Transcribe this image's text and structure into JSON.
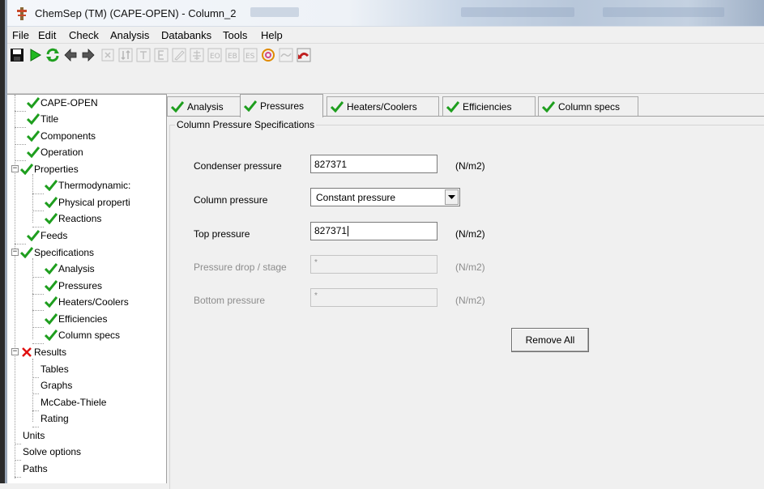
{
  "window": {
    "title": "ChemSep (TM) (CAPE-OPEN) - Column_2"
  },
  "menu": [
    "File",
    "Edit",
    "Check",
    "Analysis",
    "Databanks",
    "Tools",
    "Help"
  ],
  "toolbar": [
    {
      "icon": "save-icon",
      "enabled": true
    },
    {
      "icon": "play-icon",
      "enabled": true
    },
    {
      "icon": "refresh-icon",
      "enabled": true
    },
    {
      "icon": "arrow-left-icon",
      "enabled": true
    },
    {
      "icon": "arrow-right-icon",
      "enabled": true
    },
    {
      "icon": "close-box-icon",
      "enabled": false
    },
    {
      "icon": "sort-icon",
      "enabled": false
    },
    {
      "icon": "table-t-icon",
      "enabled": false
    },
    {
      "icon": "table-e-icon",
      "enabled": false
    },
    {
      "icon": "pen-icon",
      "enabled": false
    },
    {
      "icon": "tree-icon",
      "enabled": false
    },
    {
      "icon": "eo-icon",
      "enabled": false
    },
    {
      "icon": "eb-icon",
      "enabled": false
    },
    {
      "icon": "es-icon",
      "enabled": false
    },
    {
      "icon": "target-icon",
      "enabled": true
    },
    {
      "icon": "wave-icon",
      "enabled": false
    },
    {
      "icon": "undo-icon",
      "enabled": true
    }
  ],
  "tree": {
    "items": [
      {
        "label": "CAPE-OPEN",
        "status": "ok",
        "level": 0
      },
      {
        "label": "Title",
        "status": "ok",
        "level": 0
      },
      {
        "label": "Components",
        "status": "ok",
        "level": 0
      },
      {
        "label": "Operation",
        "status": "ok",
        "level": 0
      },
      {
        "label": "Properties",
        "status": "ok",
        "level": 0,
        "expanded": true
      },
      {
        "label": "Thermodynamic:",
        "status": "ok",
        "level": 1
      },
      {
        "label": "Physical properti",
        "status": "ok",
        "level": 1
      },
      {
        "label": "Reactions",
        "status": "ok",
        "level": 1
      },
      {
        "label": "Feeds",
        "status": "ok",
        "level": 0
      },
      {
        "label": "Specifications",
        "status": "ok",
        "level": 0,
        "expanded": true
      },
      {
        "label": "Analysis",
        "status": "ok",
        "level": 1
      },
      {
        "label": "Pressures",
        "status": "ok",
        "level": 1
      },
      {
        "label": "Heaters/Coolers",
        "status": "ok",
        "level": 1
      },
      {
        "label": "Efficiencies",
        "status": "ok",
        "level": 1
      },
      {
        "label": "Column specs",
        "status": "ok",
        "level": 1
      },
      {
        "label": "Results",
        "status": "error",
        "level": 0,
        "expanded": true
      },
      {
        "label": "Tables",
        "status": "none",
        "level": 1
      },
      {
        "label": "Graphs",
        "status": "none",
        "level": 1
      },
      {
        "label": "McCabe-Thiele",
        "status": "none",
        "level": 1
      },
      {
        "label": "Rating",
        "status": "none",
        "level": 1
      },
      {
        "label": "Units",
        "status": "none",
        "level": 0
      },
      {
        "label": "Solve options",
        "status": "none",
        "level": 0
      },
      {
        "label": "Paths",
        "status": "none",
        "level": 0
      }
    ]
  },
  "tabs": [
    {
      "label": "Analysis",
      "active": false
    },
    {
      "label": "Pressures",
      "active": true
    },
    {
      "label": "Heaters/Coolers",
      "active": false
    },
    {
      "label": "Efficiencies",
      "active": false
    },
    {
      "label": "Column specs",
      "active": false
    }
  ],
  "form": {
    "group_title": "Column Pressure Specifications",
    "condenser_pressure": {
      "label": "Condenser pressure",
      "value": "827371",
      "unit": "(N/m2)"
    },
    "column_pressure": {
      "label": "Column pressure",
      "value": "Constant pressure"
    },
    "top_pressure": {
      "label": "Top pressure",
      "value": "827371",
      "unit": "(N/m2)"
    },
    "pressure_drop": {
      "label": "Pressure drop / stage",
      "value": "*",
      "unit": "(N/m2)"
    },
    "bottom_pressure": {
      "label": "Bottom pressure",
      "value": "*",
      "unit": "(N/m2)"
    },
    "remove_all_label": "Remove All"
  },
  "colors": {
    "check_green": "#1e9e1e",
    "error_red": "#e01010",
    "disabled_text": "#8d8d8d"
  }
}
